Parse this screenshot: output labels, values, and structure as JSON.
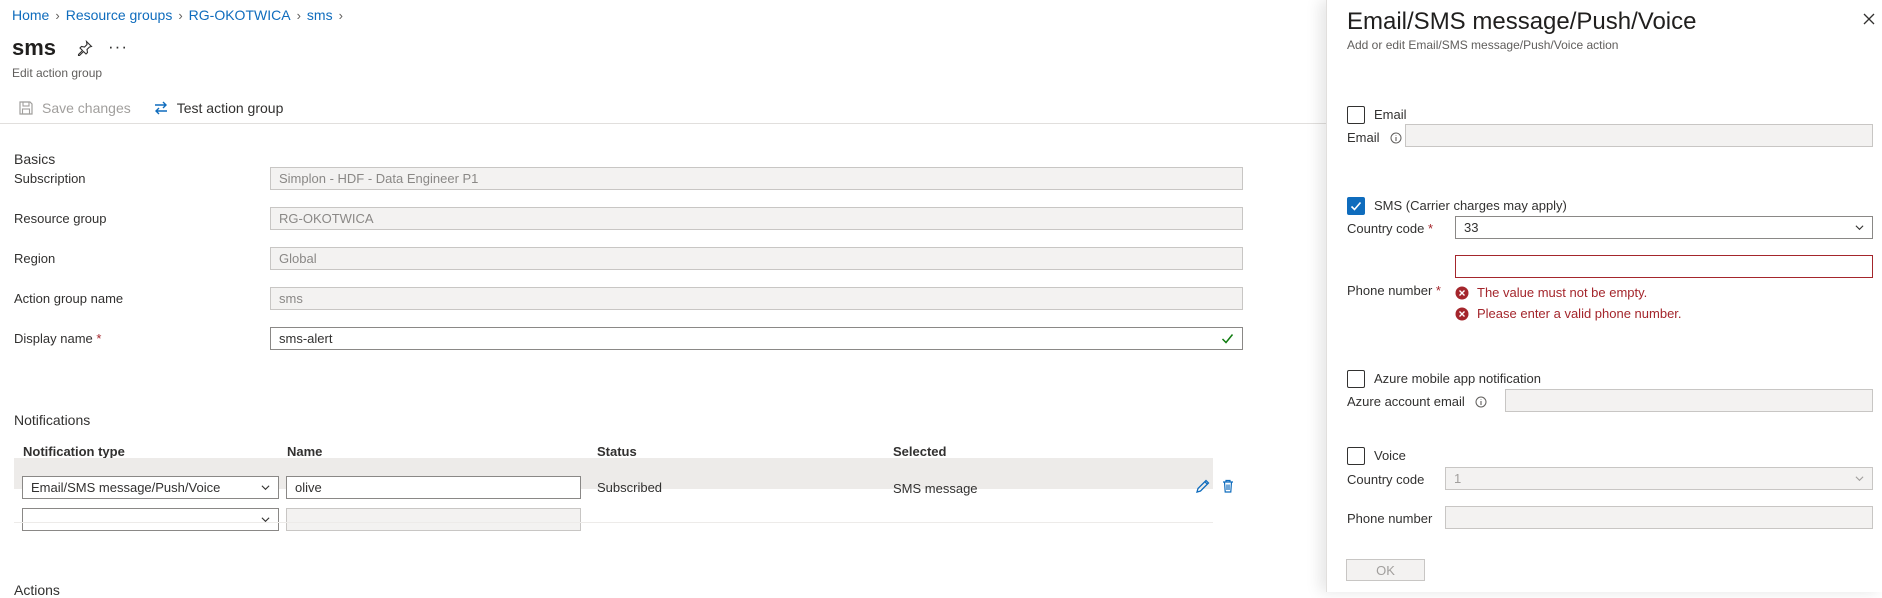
{
  "breadcrumb": [
    {
      "label": "Home"
    },
    {
      "label": "Resource groups"
    },
    {
      "label": "RG-OKOTWICA"
    },
    {
      "label": "sms"
    }
  ],
  "page": {
    "title": "sms",
    "subtitle": "Edit action group",
    "more_label": "···"
  },
  "toolbar": {
    "save_label": "Save changes",
    "test_label": "Test action group"
  },
  "basics": {
    "heading": "Basics",
    "subscription_label": "Subscription",
    "subscription_value": "Simplon - HDF - Data Engineer P1",
    "resource_group_label": "Resource group",
    "resource_group_value": "RG-OKOTWICA",
    "region_label": "Region",
    "region_value": "Global",
    "action_group_name_label": "Action group name",
    "action_group_name_value": "sms",
    "display_name_label": "Display name",
    "display_name_value": "sms-alert",
    "required_marker": "*"
  },
  "notifications": {
    "heading": "Notifications",
    "columns": [
      "Notification type",
      "Name",
      "Status",
      "Selected"
    ],
    "rows": [
      {
        "type": "Email/SMS message/Push/Voice",
        "name": "olive",
        "status": "Subscribed",
        "selected": "SMS message"
      }
    ]
  },
  "actions": {
    "heading": "Actions"
  },
  "panel": {
    "title": "Email/SMS message/Push/Voice",
    "subtitle": "Add or edit Email/SMS message/Push/Voice action",
    "email": {
      "checkbox_label": "Email",
      "checked": false,
      "field_label": "Email",
      "value": ""
    },
    "sms": {
      "checkbox_label": "SMS (Carrier charges may apply)",
      "checked": true,
      "country_label": "Country code",
      "country_value": "33",
      "phone_label": "Phone number",
      "phone_value": "",
      "errors": [
        "The value must not be empty.",
        "Please enter a valid phone number."
      ]
    },
    "push": {
      "checkbox_label": "Azure mobile app notification",
      "checked": false,
      "field_label": "Azure account email",
      "value": ""
    },
    "voice": {
      "checkbox_label": "Voice",
      "checked": false,
      "country_label": "Country code",
      "country_value": "1",
      "phone_label": "Phone number",
      "phone_value": ""
    },
    "ok_label": "OK"
  },
  "colors": {
    "accent": "#0f6cbd",
    "error": "#a4262c",
    "success": "#107c10"
  }
}
